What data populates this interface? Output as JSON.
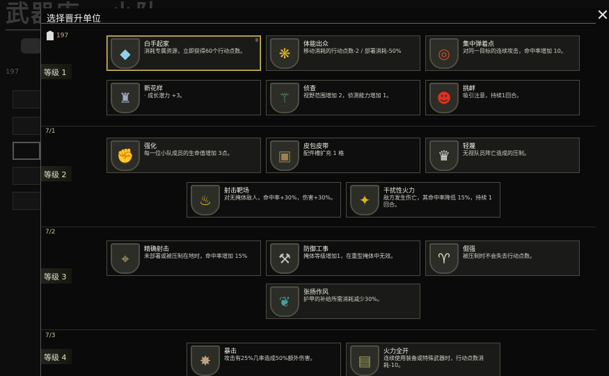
{
  "background": {
    "title": "武器库 · 小队",
    "count": "197"
  },
  "modal": {
    "title": "选择晋升单位",
    "close_label": "✕",
    "points": "197"
  },
  "levels": [
    {
      "label": "等级 1"
    },
    {
      "label": "等级 2",
      "progress": "7/1"
    },
    {
      "label": "等级 3",
      "progress": "7/2"
    },
    {
      "label": "等级 4",
      "progress": "7/3"
    }
  ],
  "cards": [
    {
      "name": "白手起家",
      "desc": "消耗专属资源，立即获得60个行动点数。",
      "icon": "diamond-icon",
      "glyph": "◆",
      "color": "#8fd0f0"
    },
    {
      "name": "体能出众",
      "desc": "移动消耗的行动点数-2 / 部署消耗-50%",
      "icon": "winged-boot-icon",
      "glyph": "❋",
      "color": "#e0b030"
    },
    {
      "name": "集中弹着点",
      "desc": "对同一目标的连续攻击，命中率增加 10。",
      "icon": "target-soldier-icon",
      "glyph": "◎",
      "color": "#d05030"
    },
    {
      "name": "新花样",
      "desc": "· 成长潜力 +3。",
      "icon": "officer-cap-icon",
      "glyph": "♜",
      "color": "#a0a8c0"
    },
    {
      "name": "侦查",
      "desc": "视野范围增加 2，侦测能力增加 1。",
      "icon": "bat-icon",
      "glyph": "⚚",
      "color": "#50a070"
    },
    {
      "name": "挑衅",
      "desc": "吸引注意，持续1回合。",
      "icon": "devil-face-icon",
      "glyph": "☻",
      "color": "#e03020"
    },
    {
      "name": "强化",
      "desc": "每一位小队成员的生命值增加 3点。",
      "icon": "flexed-arm-icon",
      "glyph": "✊",
      "color": "#c04040"
    },
    {
      "name": "皮包皮带",
      "desc": "配件槽扩充 1 格",
      "icon": "backpack-icon",
      "glyph": "▣",
      "color": "#a08050"
    },
    {
      "name": "轻蔑",
      "desc": "无视队员阵亡造成的压制。",
      "icon": "skull-crown-icon",
      "glyph": "♛",
      "color": "#e0e0e0"
    },
    {
      "name": "射击靶场",
      "desc": "对无掩体敌人，命中率+30%，伤害+30%。",
      "icon": "duck-target-icon",
      "glyph": "♨",
      "color": "#e0c020"
    },
    {
      "name": "干扰性火力",
      "desc": "敌方发生伤亡，其命中率降低 15%，持续 1 回合。",
      "icon": "suppression-icon",
      "glyph": "✦",
      "color": "#e0b020"
    },
    {
      "name": "精确射击",
      "desc": "未部署或被压制在地时，命中率增加 15%",
      "icon": "sniper-icon",
      "glyph": "⌖",
      "color": "#c0a070"
    },
    {
      "name": "防御工事",
      "desc": "掩体等级增加1，在重型掩体中无效。",
      "icon": "shovel-icon",
      "glyph": "⚒",
      "color": "#c0c0c0"
    },
    {
      "name": "倔强",
      "desc": "被压制时不会失去行动点数。",
      "icon": "ram-icon",
      "glyph": "♈",
      "color": "#e0d8c0"
    },
    {
      "name": "张扬作风",
      "desc": "护甲的补给所需消耗减少30%。",
      "icon": "peacock-icon",
      "glyph": "❦",
      "color": "#40a0a0"
    },
    {
      "name": "暴击",
      "desc": "攻击有25%几率造成50%额外伤害。",
      "icon": "rat-icon",
      "glyph": "✸",
      "color": "#c0a080"
    },
    {
      "name": "火力全开",
      "desc": "连续使用装备或特殊武器时，行动点数消耗-10。",
      "icon": "machine-gun-icon",
      "glyph": "▤",
      "color": "#a0a060"
    }
  ]
}
